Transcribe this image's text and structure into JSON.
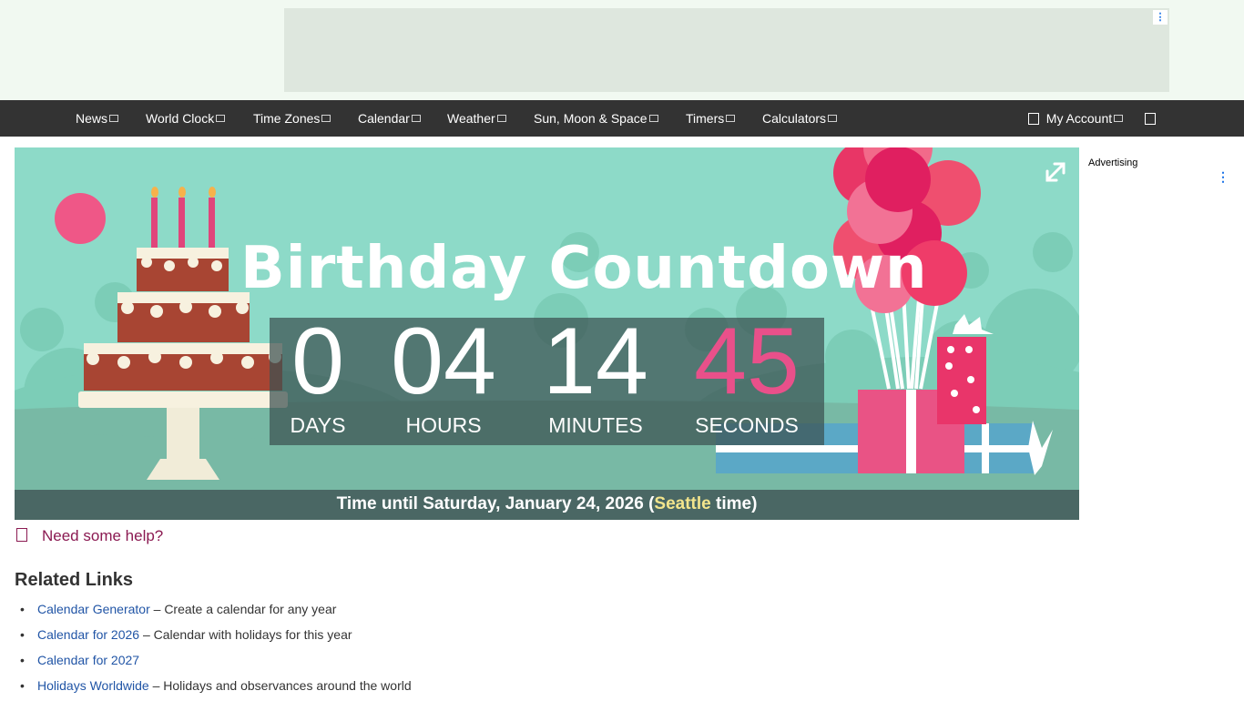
{
  "nav": {
    "items": [
      {
        "label": "News",
        "key": "news"
      },
      {
        "label": "World Clock",
        "key": "world-clock"
      },
      {
        "label": "Time Zones",
        "key": "time-zones"
      },
      {
        "label": "Calendar",
        "key": "calendar"
      },
      {
        "label": "Weather",
        "key": "weather"
      },
      {
        "label": "Sun, Moon & Space",
        "key": "sun-moon-space"
      },
      {
        "label": "Timers",
        "key": "timers"
      },
      {
        "label": "Calculators",
        "key": "calculators"
      }
    ],
    "account_label": "My Account"
  },
  "hero": {
    "title": "Birthday Countdown",
    "countdown": {
      "days": "0",
      "hours": "04",
      "minutes": "14",
      "seconds": "45",
      "days_label": "DAYS",
      "hours_label": "HOURS",
      "minutes_label": "MINUTES",
      "seconds_label": "SECONDS"
    },
    "until_prefix": "Time until Saturday, January 24, 2026 (",
    "until_location": "Seattle",
    "until_suffix": " time)"
  },
  "sidebar": {
    "advertising_label": "Advertising"
  },
  "help": {
    "label": "Need some help?"
  },
  "related": {
    "title": "Related Links",
    "links": [
      {
        "text": "Calendar Generator",
        "desc": " – Create a calendar for any year"
      },
      {
        "text": "Calendar for 2026",
        "desc": " – Calendar with holidays for this year"
      },
      {
        "text": "Calendar for 2027",
        "desc": ""
      },
      {
        "text": "Holidays Worldwide",
        "desc": " – Holidays and observances around the world"
      }
    ]
  },
  "colors": {
    "nav_bg": "#333333",
    "hero_bg": "#8ddac8",
    "seconds_accent": "#e9508a",
    "link": "#2155a6",
    "help": "#8b1a52"
  }
}
